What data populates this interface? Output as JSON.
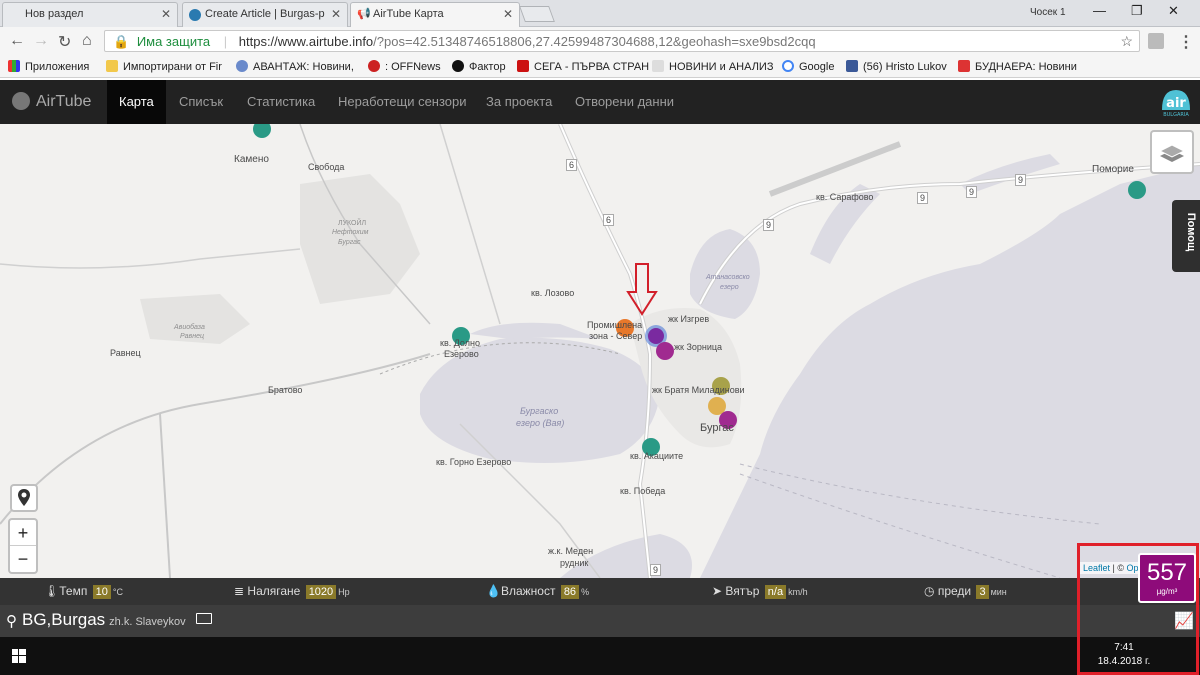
{
  "browser": {
    "tabs": [
      {
        "title": "Нов раздел",
        "active": false
      },
      {
        "title": "Create Article | Burgas-p",
        "active": false
      },
      {
        "title": "AirTube Карта",
        "active": true
      }
    ],
    "window_label": "Чосек 1",
    "secure_label": "Има защита",
    "url_host": "https://www.airtube.info",
    "url_rest": "/?pos=42.51348746518806,27.42599487304688,12&geohash=sxe9bsd2cqq",
    "bookmarks": [
      "Приложения",
      "Импортирани от Fir",
      "АВАНТАЖ: Новини,",
      ": OFFNews",
      "Фактор",
      "СЕГА - ПЪРВА СТРАН",
      "НОВИНИ и АНАЛИЗ",
      "Google",
      "(56) Hristo Lukov",
      "БУДНАЕРА: Новини"
    ]
  },
  "app": {
    "brand": "AirTube",
    "nav": [
      "Карта",
      "Списък",
      "Статистика",
      "Неработещи сензори",
      "За проекта",
      "Отворени данни"
    ],
    "help": "Помощ",
    "logo_text": "air",
    "logo_sub": "BULGARIA"
  },
  "map": {
    "labels": {
      "kameno": "Камено",
      "svoboda": "Свобода",
      "lukoil": "ЛУКОЙЛ",
      "neftochim": "Нефтохим",
      "burgas_small": "Бургас",
      "aviobaza": "Авиобаза",
      "ravnets_small": "Равнец",
      "ravnets": "Равнец",
      "bratovo": "Братово",
      "dolno_ezerovo_1": "кв. Долно",
      "dolno_ezerovo_2": "Езерово",
      "lozovo": "кв. Лозово",
      "promishlena_1": "Промишлена",
      "promishlena_2": "зона - Север",
      "izgrev": "жк Изгрев",
      "zornitsa": "жк Зорница",
      "bratya": "жк Братя Миладинови",
      "burgas": "Бургас",
      "akatsiite": "кв. Акациите",
      "pobeda": "кв. Победа",
      "gorno_ezerovo": "кв. Горно Езерово",
      "meden_1": "ж.к. Меден",
      "meden_2": "рудник",
      "sarafovo": "кв. Сарафово",
      "pomorie": "Поморие",
      "atanasovsko_1": "Атанасовско",
      "atanasovsko_2": "езеро",
      "lake_1": "Бургаско",
      "lake_2": "езеро (Вая)",
      "road_6a": "6",
      "road_6b": "6",
      "road_9a": "9",
      "road_9b": "9",
      "road_9c": "9",
      "road_9d": "9",
      "road_9e": "9"
    },
    "sensors": [
      {
        "name": "Камено",
        "color": "#2a9a86"
      },
      {
        "name": "Долно Езерово",
        "color": "#2a9a86"
      },
      {
        "name": "Промишлена зона",
        "color": "#e8782a"
      },
      {
        "name": "Изгрев selected",
        "color": "#7a2aa0"
      },
      {
        "name": "Зорница",
        "color": "#a02a90"
      },
      {
        "name": "Братя Миладинови",
        "color": "#a8a24a"
      },
      {
        "name": "Бургас 1",
        "color": "#e0b050"
      },
      {
        "name": "Бургас 2",
        "color": "#a02a90"
      },
      {
        "name": "Акациите",
        "color": "#2a9a86"
      },
      {
        "name": "Поморие",
        "color": "#2a9a86"
      }
    ],
    "zoom_in": "+",
    "zoom_out": "−",
    "attribution_leaflet": "Leaflet",
    "attribution_sep": " | © ",
    "attribution_osm": "Op"
  },
  "reading": {
    "value": "557",
    "unit": "µg/m³",
    "color": "#8e0b7a"
  },
  "info": {
    "temp_label": "Темп",
    "temp_value": "10",
    "temp_unit": "°C",
    "pressure_label": "Налягане",
    "pressure_value": "1020",
    "pressure_unit": "Hp",
    "humidity_label": "Влажност",
    "humidity_value": "86",
    "humidity_unit": "%",
    "wind_label": "Вятър",
    "wind_value": "n/a",
    "wind_unit": "km/h",
    "ago_label": "преди",
    "ago_value": "3",
    "ago_unit": "мин"
  },
  "location": {
    "city": "BG,Burgas",
    "district": "zh.k. Slaveykov"
  },
  "taskbar": {
    "time": "7:41",
    "date": "18.4.2018 г."
  }
}
